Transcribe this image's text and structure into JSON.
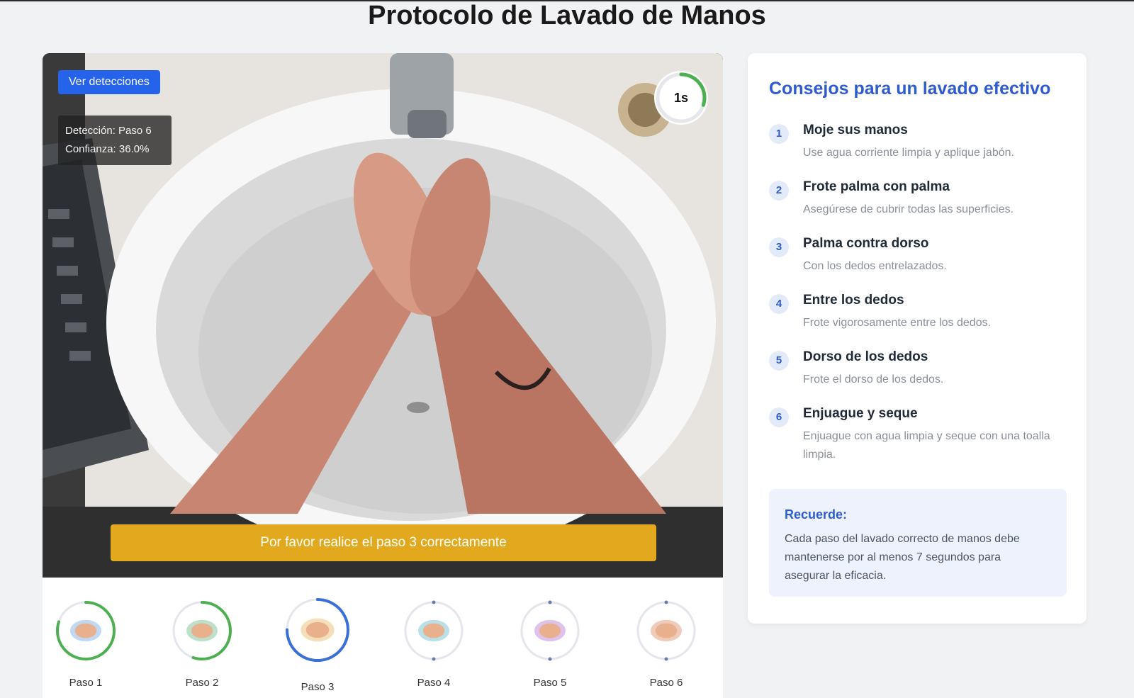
{
  "page": {
    "title": "Protocolo de Lavado de Manos"
  },
  "video": {
    "detections_button": "Ver detecciones",
    "detection_line": "Detección: Paso 6",
    "confidence_line": "Confianza: 36.0%",
    "timer_label": "1s",
    "timer_progress": 0.3,
    "alert_text": "Por favor realice el paso 3 correctamente"
  },
  "steps": [
    {
      "label": "Paso 1",
      "state": "done",
      "progress": 0.8,
      "color": "#4caf50"
    },
    {
      "label": "Paso 2",
      "state": "done",
      "progress": 0.55,
      "color": "#4caf50"
    },
    {
      "label": "Paso 3",
      "state": "active",
      "progress": 0.75,
      "color": "#3b6fd8"
    },
    {
      "label": "Paso 4",
      "state": "pending",
      "progress": 0,
      "color": "#cfd6e3"
    },
    {
      "label": "Paso 5",
      "state": "pending",
      "progress": 0,
      "color": "#cfd6e3"
    },
    {
      "label": "Paso 6",
      "state": "pending",
      "progress": 0,
      "color": "#cfd6e3"
    }
  ],
  "tips": {
    "title": "Consejos para un lavado efectivo",
    "items": [
      {
        "num": "1",
        "title": "Moje sus manos",
        "desc": "Use agua corriente limpia y aplique jabón."
      },
      {
        "num": "2",
        "title": "Frote palma con palma",
        "desc": "Asegúrese de cubrir todas las superficies."
      },
      {
        "num": "3",
        "title": "Palma contra dorso",
        "desc": "Con los dedos entrelazados."
      },
      {
        "num": "4",
        "title": "Entre los dedos",
        "desc": "Frote vigorosamente entre los dedos."
      },
      {
        "num": "5",
        "title": "Dorso de los dedos",
        "desc": "Frote el dorso de los dedos."
      },
      {
        "num": "6",
        "title": "Enjuague y seque",
        "desc": "Enjuague con agua limpia y seque con una toalla limpia."
      }
    ],
    "remember_title": "Recuerde:",
    "remember_text": "Cada paso del lavado correcto de manos debe mantenerse por al menos 7 segundos para asegurar la eficacia."
  },
  "colors": {
    "accent": "#2563eb",
    "alert": "#e2a91e",
    "success": "#4caf50"
  }
}
